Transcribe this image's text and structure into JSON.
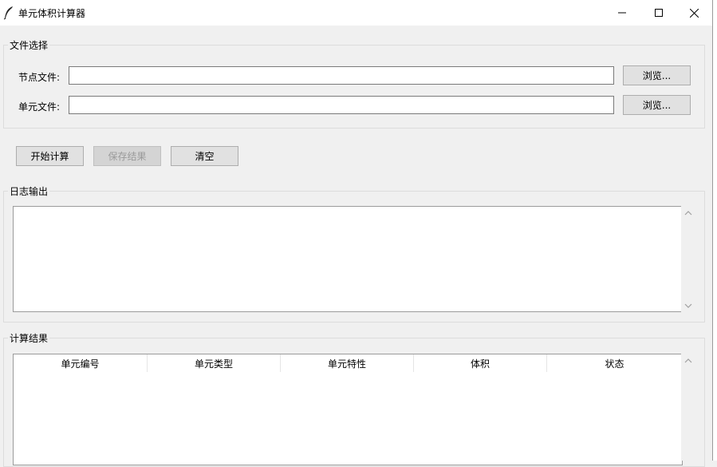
{
  "window": {
    "title": "单元体积计算器",
    "icon": "feather-icon",
    "controls": [
      "minimize-icon",
      "maximize-icon",
      "close-icon"
    ]
  },
  "file_select": {
    "group_label": "文件选择",
    "node_label": "节点文件:",
    "node_value": "",
    "element_label": "单元文件:",
    "element_value": "",
    "browse_label": "浏览..."
  },
  "actions": {
    "start_label": "开始计算",
    "save_label": "保存结果",
    "clear_label": "清空"
  },
  "log": {
    "group_label": "日志输出",
    "content": ""
  },
  "results": {
    "group_label": "计算结果",
    "columns": [
      "单元编号",
      "单元类型",
      "单元特性",
      "体积",
      "状态"
    ],
    "rows": []
  },
  "colors": {
    "background": "#f0f0f0",
    "button": "#e1e1e1",
    "disabled_text": "#9a9a9a"
  }
}
